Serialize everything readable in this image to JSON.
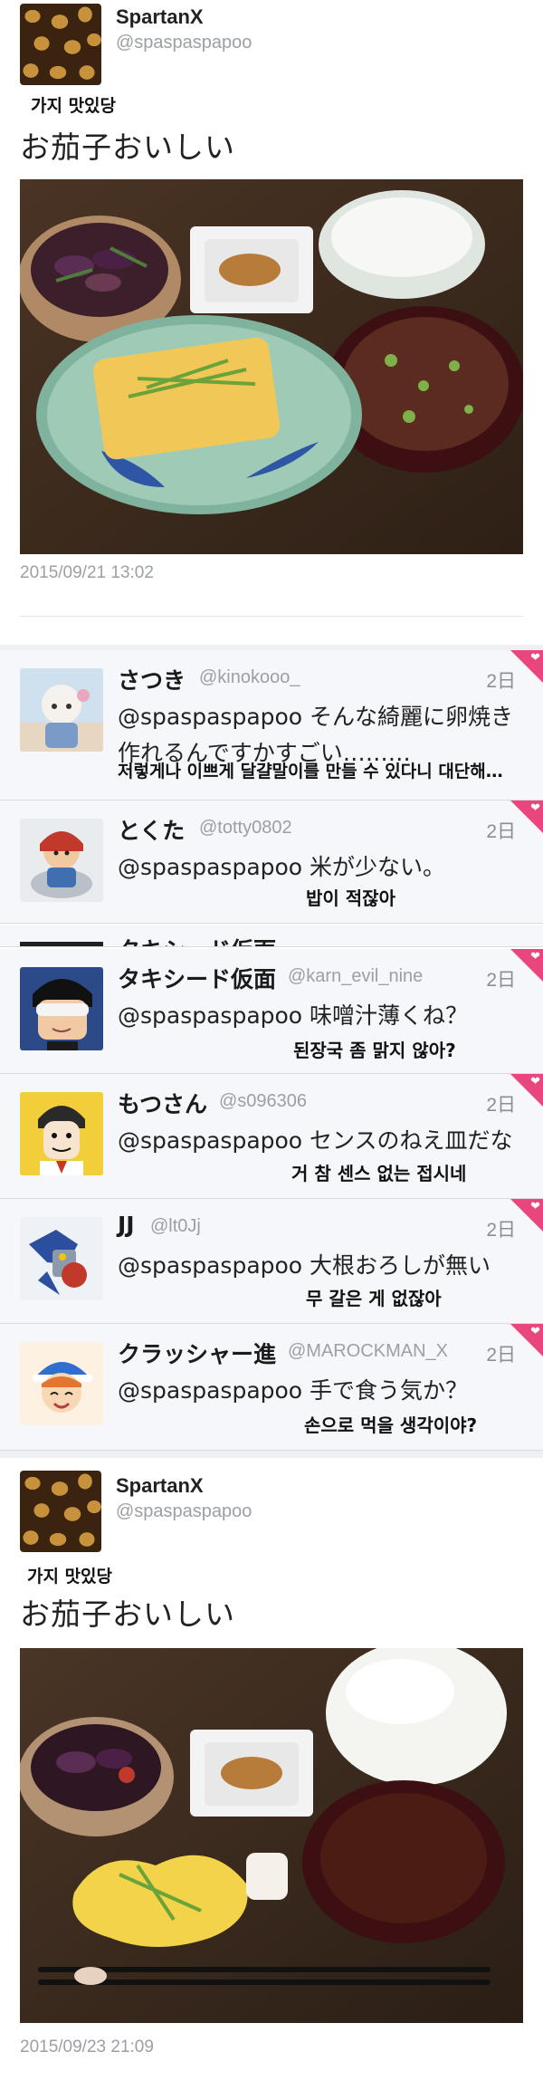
{
  "tweet_top": {
    "name": "SpartanX",
    "handle": "@spaspaspapoo",
    "translation_note": "가지 맛있당",
    "text": "お茄子おいしい",
    "timestamp": "2015/09/21 13:02",
    "avatar_icon": "giraffe-pattern-avatar",
    "photo_icon": "meal-photo"
  },
  "replies": [
    {
      "name": "さつき",
      "handle": "@kinokooo_",
      "age": "2日",
      "text": "@spaspaspapoo そんな綺麗に卵焼き作れるんですかすごい………",
      "translation": "저렇게나 이쁘게 달걀말이를 만들 수 있다니 대단해…",
      "avatar_icon": "anime-girl-avatar"
    },
    {
      "name": "とくた",
      "handle": "@totty0802",
      "age": "2日",
      "text": "@spaspaspapoo 米が少ない。",
      "translation": "밥이 적잖아",
      "avatar_icon": "figurine-avatar"
    },
    {
      "name": "タキシード仮面",
      "handle": "@karn_evil_nine",
      "age": "2日",
      "text": "@spaspaspapoo 味噌汁薄くね？",
      "translation": "된장국 좀 맑지 않아?",
      "avatar_icon": "masked-hero-avatar"
    },
    {
      "name": "もつさん",
      "handle": "@s096306",
      "age": "2日",
      "text": "@spaspaspapoo センスのねえ皿だな",
      "translation": "거 참 센스 없는 접시네",
      "avatar_icon": "manga-man-avatar"
    },
    {
      "name": "JJ",
      "handle": "@lt0Jj",
      "age": "2日",
      "text": "@spaspaspapoo 大根おろしが無い",
      "translation": "무 갈은 게 없잖아",
      "avatar_icon": "robot-avatar"
    },
    {
      "name": "クラッシャー進",
      "handle": "@MAROCKMAN_X",
      "age": "2日",
      "text": "@spaspaspapoo 手で食う気か？",
      "translation": "손으로 먹을 생각이야?",
      "avatar_icon": "cap-boy-avatar"
    }
  ],
  "ghost_reply": {
    "name": "タキシード仮面"
  },
  "tweet_bottom": {
    "name": "SpartanX",
    "handle": "@spaspaspapoo",
    "translation_note": "가지 맛있당",
    "text": "お茄子おいしい",
    "timestamp": "2015/09/23 21:09",
    "avatar_icon": "giraffe-pattern-avatar",
    "photo_icon": "meal-photo"
  },
  "colors": {
    "like_corner": "#e8467c",
    "muted_text": "#9aa0a6",
    "reply_bg": "#f5f7fa"
  }
}
